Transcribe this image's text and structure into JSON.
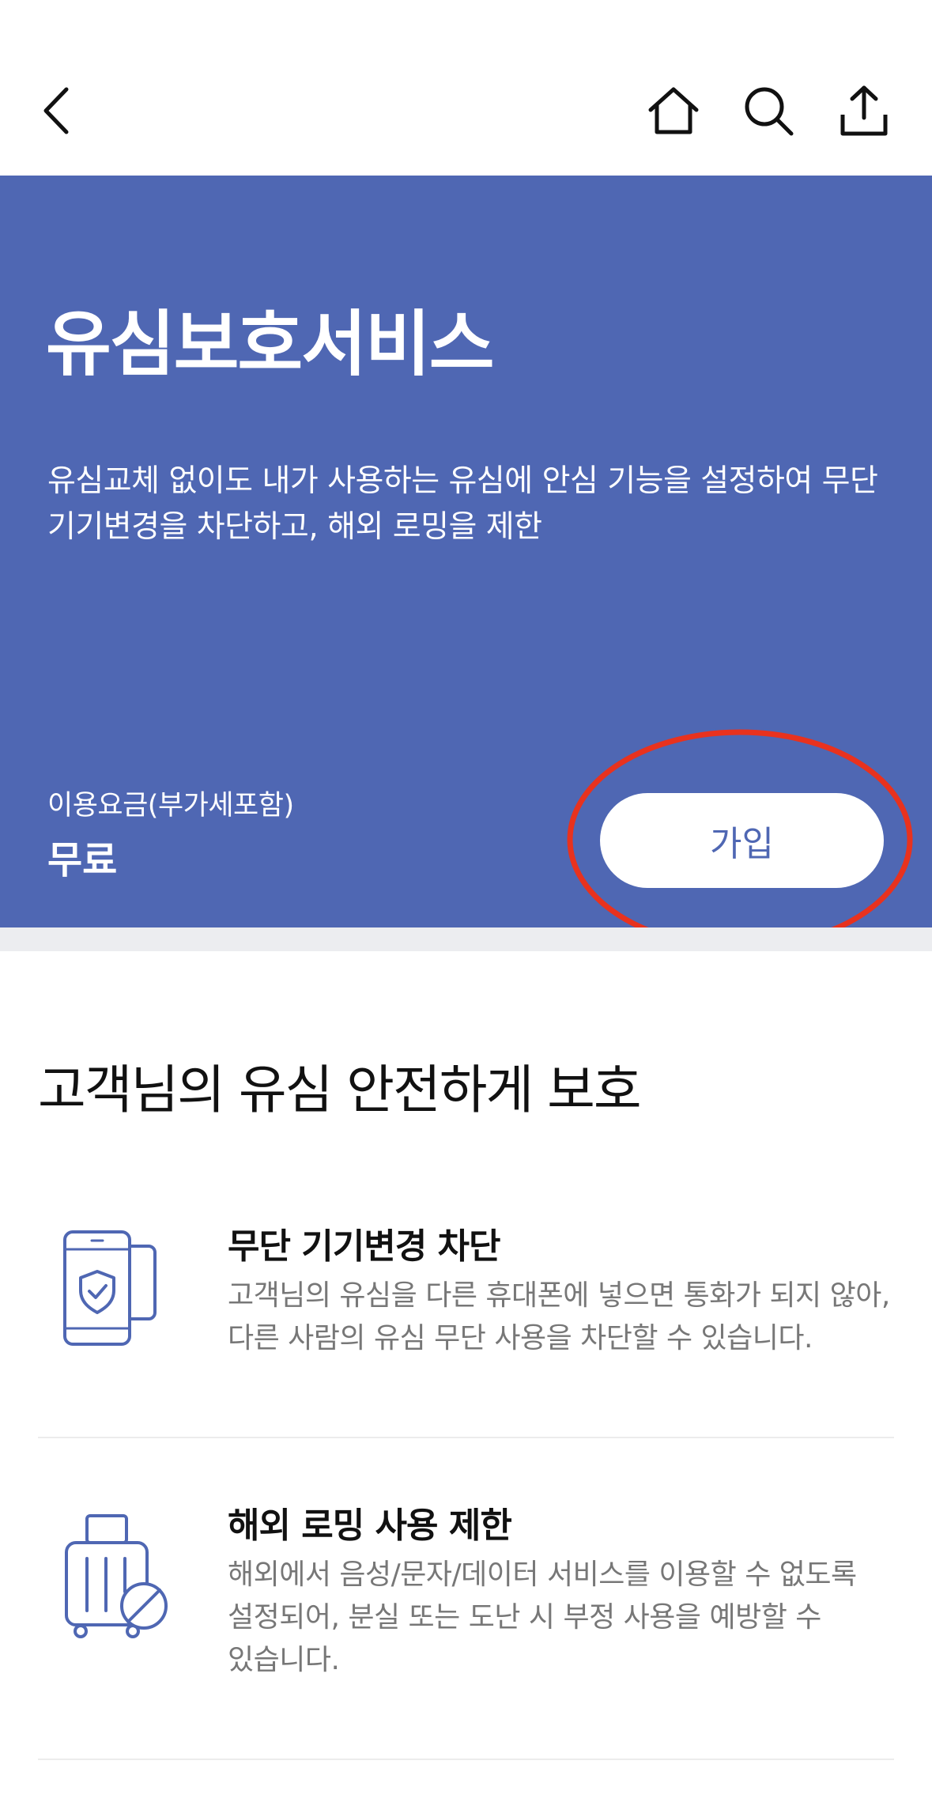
{
  "header": {
    "back_icon": "chevron-left-icon",
    "home_icon": "home-icon",
    "search_icon": "search-icon",
    "share_icon": "share-icon"
  },
  "hero": {
    "title": "유심보호서비스",
    "description_line1": "유심교체 없이도 내가 사용하는 유심에 안심 기능을 설정하여 무단",
    "description_line2": "기기변경을 차단하고, 해외 로밍을 제한",
    "fee_label": "이용요금(부가세포함)",
    "fee_value": "무료",
    "join_label": "가입",
    "background_color": "#4f67b3"
  },
  "section": {
    "title": "고객님의 유심 안전하게 보호"
  },
  "features": [
    {
      "icon": "phone-shield-icon",
      "title": "무단 기기변경 차단",
      "desc_line1": "고객님의 유심을 다른 휴대폰에 넣으면 통화가 되지 않아,",
      "desc_line2": "다른 사람의 유심 무단 사용을 차단할 수 있습니다."
    },
    {
      "icon": "luggage-blocked-icon",
      "title": "해외 로밍 사용 제한",
      "desc_line1": "해외에서 음성/문자/데이터 서비스를 이용할 수 없도록",
      "desc_line2": "설정되어, 분실 또는 도난 시 부정 사용을 예방할 수",
      "desc_line3": "있습니다."
    }
  ]
}
